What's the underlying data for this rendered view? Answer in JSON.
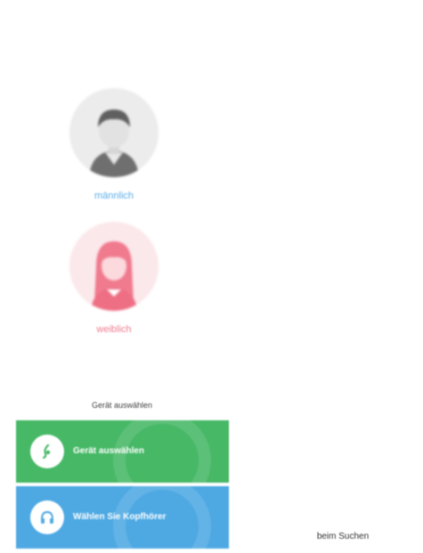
{
  "header": {
    "caption": ""
  },
  "gender": {
    "male": {
      "label": "männlich",
      "color": "#5aaee8",
      "icon": "male-avatar-icon"
    },
    "female": {
      "label": "weiblich",
      "color": "#f07a8e",
      "icon": "female-avatar-icon"
    }
  },
  "device_section": {
    "title": "Gerät auswählen",
    "cards": [
      {
        "label": "Gerät auswählen",
        "color": "#46b866",
        "icon": "device-icon"
      },
      {
        "label": "Wählen Sie Kopfhörer",
        "color": "#4ea9e3",
        "icon": "headphones-icon"
      }
    ]
  },
  "search_panel": {
    "title": "beim Suchen",
    "subtitle": ""
  }
}
